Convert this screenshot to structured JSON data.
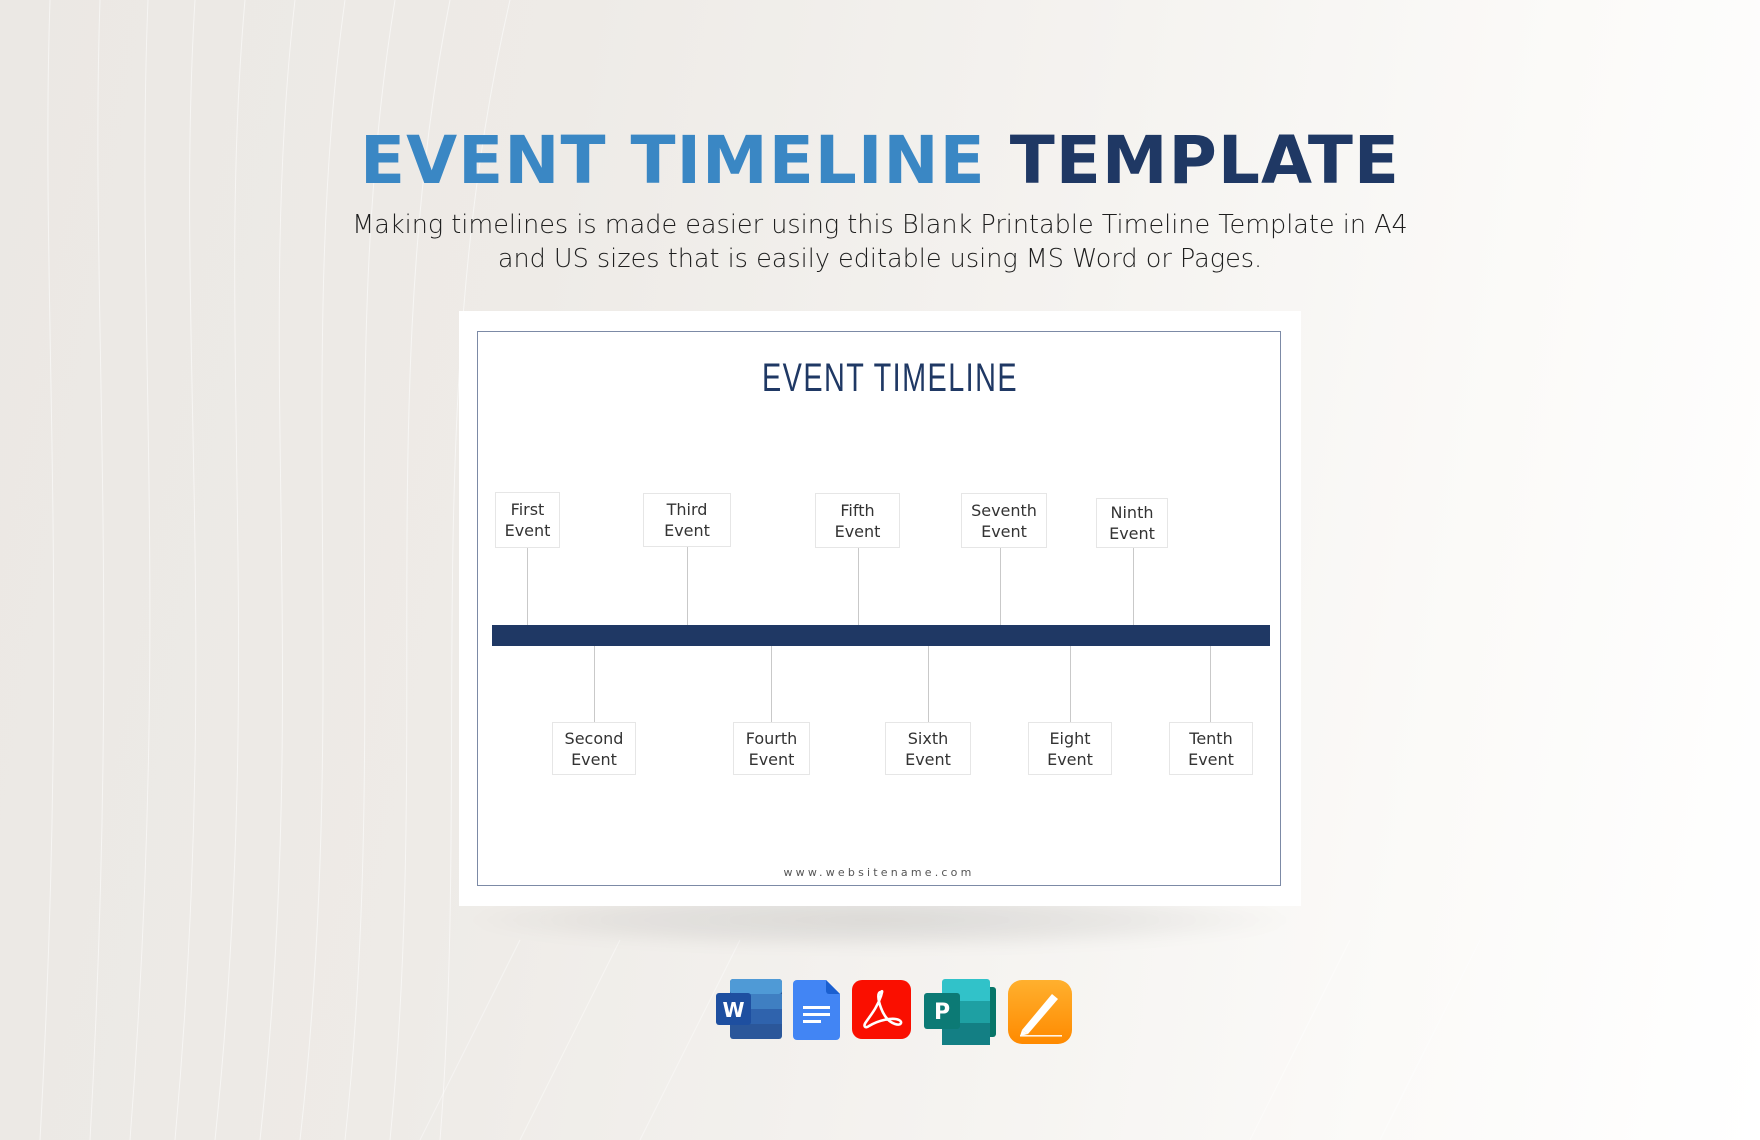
{
  "hero": {
    "title_part1": "EVENT TIMELINE",
    "title_part2": "TEMPLATE",
    "subtitle_line1": "Making timelines is made easier using this Blank Printable Timeline Template in A4",
    "subtitle_line2": "and US sizes that is easily editable using MS Word or Pages."
  },
  "document": {
    "title": "EVENT TIMELINE",
    "website": "www.websitename.com",
    "events_above": [
      {
        "line1": "First",
        "line2": "Event"
      },
      {
        "line1": "Third",
        "line2": "Event"
      },
      {
        "line1": "Fifth",
        "line2": "Event"
      },
      {
        "line1": "Seventh",
        "line2": "Event"
      },
      {
        "line1": "Ninth",
        "line2": "Event"
      }
    ],
    "events_below": [
      {
        "line1": "Second",
        "line2": "Event"
      },
      {
        "line1": "Fourth",
        "line2": "Event"
      },
      {
        "line1": "Sixth",
        "line2": "Event"
      },
      {
        "line1": "Eight",
        "line2": "Event"
      },
      {
        "line1": "Tenth",
        "line2": "Event"
      }
    ]
  },
  "formats": [
    {
      "name": "Microsoft Word",
      "icon": "word-icon"
    },
    {
      "name": "Google Docs",
      "icon": "google-docs-icon"
    },
    {
      "name": "Adobe PDF",
      "icon": "adobe-pdf-icon"
    },
    {
      "name": "Microsoft Publisher",
      "icon": "publisher-icon"
    },
    {
      "name": "Apple Pages",
      "icon": "pages-icon"
    }
  ],
  "colors": {
    "title_blue": "#3a87c4",
    "title_navy": "#1f3864",
    "timeline_bar": "#1f3864",
    "frame_border": "#7c8aa6"
  }
}
